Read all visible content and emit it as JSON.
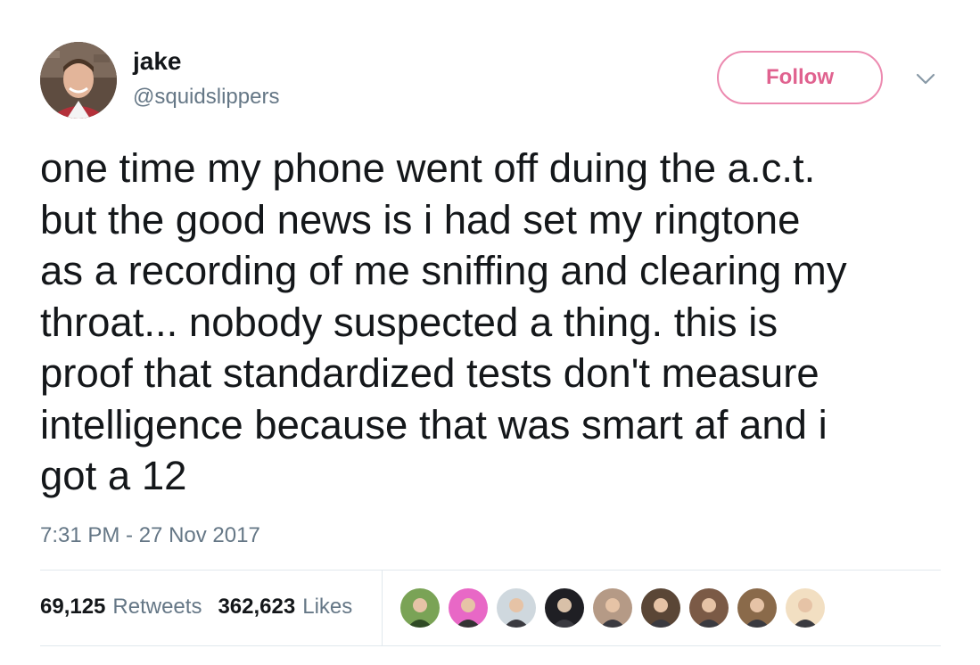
{
  "user": {
    "name": "jake",
    "handle": "@squidslippers",
    "avatar_icon": "profile-photo"
  },
  "follow_button": {
    "label": "Follow",
    "color": "#e0628f"
  },
  "caret_icon": "chevron-down-icon",
  "tweet": {
    "text": "one time my phone went off duing the a.c.t.\nbut the good news is i had set my ringtone\nas a recording of me sniffing and clearing my\nthroat... nobody suspected a thing. this is\nproof that standardized tests don't measure\nintelligence because that was smart af and i\ngot a 12",
    "timestamp": "7:31 PM - 27 Nov 2017"
  },
  "stats": {
    "retweets_count": "69,125",
    "retweets_label": "Retweets",
    "likes_count": "362,623",
    "likes_label": "Likes"
  },
  "likers": [
    {
      "icon": "liker-avatar-1",
      "color": "#7aa356"
    },
    {
      "icon": "liker-avatar-2",
      "color": "#e868c6"
    },
    {
      "icon": "liker-avatar-3",
      "color": "#cfd8de"
    },
    {
      "icon": "liker-avatar-4",
      "color": "#1f1f24"
    },
    {
      "icon": "liker-avatar-5",
      "color": "#b59a86"
    },
    {
      "icon": "liker-avatar-6",
      "color": "#5a4636"
    },
    {
      "icon": "liker-avatar-7",
      "color": "#7b5a46"
    },
    {
      "icon": "liker-avatar-8",
      "color": "#8a6a4a"
    },
    {
      "icon": "liker-avatar-9",
      "color": "#f2dfc2"
    }
  ]
}
